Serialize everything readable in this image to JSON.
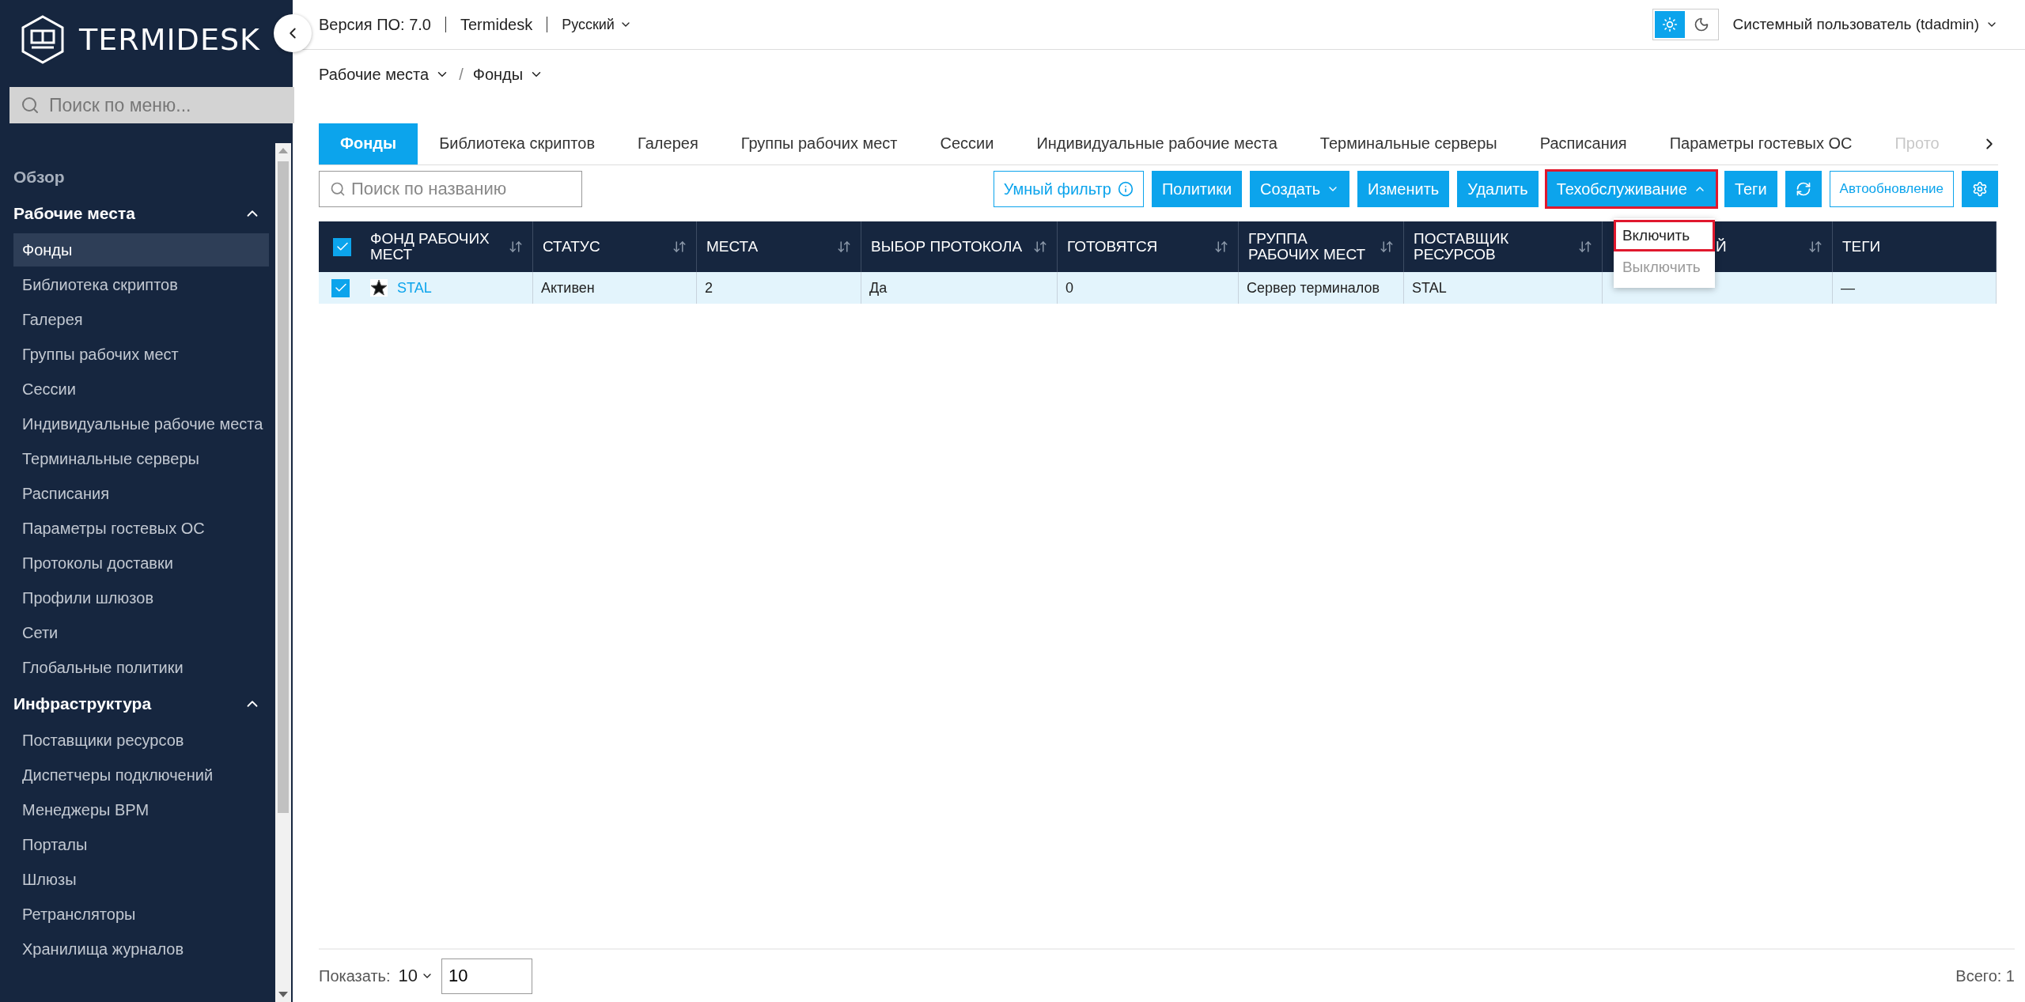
{
  "sidebar": {
    "logo": "TERMIDESK",
    "search": {
      "placeholder": "Поиск по меню..."
    },
    "sections": [
      {
        "kind": "link",
        "label": "Обзор"
      },
      {
        "kind": "group",
        "label": "Рабочие места",
        "expanded": true,
        "children": [
          {
            "label": "Фонды",
            "selected": true
          },
          {
            "label": "Библиотека скриптов",
            "selected": false
          },
          {
            "label": "Галерея",
            "selected": false
          },
          {
            "label": "Группы рабочих мест",
            "selected": false
          },
          {
            "label": "Сессии",
            "selected": false
          },
          {
            "label": "Индивидуальные рабочие места",
            "selected": false
          },
          {
            "label": "Терминальные серверы",
            "selected": false
          },
          {
            "label": "Расписания",
            "selected": false
          },
          {
            "label": "Параметры гостевых ОС",
            "selected": false
          },
          {
            "label": "Протоколы доставки",
            "selected": false
          },
          {
            "label": "Профили шлюзов",
            "selected": false
          },
          {
            "label": "Сети",
            "selected": false
          },
          {
            "label": "Глобальные политики",
            "selected": false
          }
        ]
      },
      {
        "kind": "group",
        "label": "Инфраструктура",
        "expanded": true,
        "children": [
          {
            "label": "Поставщики ресурсов",
            "selected": false
          },
          {
            "label": "Диспетчеры подключений",
            "selected": false
          },
          {
            "label": "Менеджеры ВРМ",
            "selected": false
          },
          {
            "label": "Порталы",
            "selected": false
          },
          {
            "label": "Шлюзы",
            "selected": false
          },
          {
            "label": "Ретрансляторы",
            "selected": false
          },
          {
            "label": "Хранилища журналов",
            "selected": false
          }
        ]
      }
    ]
  },
  "topbar": {
    "items": [
      "Версия ПО: 7.0",
      "Termidesk"
    ],
    "language": "Русский",
    "theme": [
      {
        "kind": "light",
        "selected": true
      },
      {
        "kind": "dark",
        "selected": false
      }
    ],
    "user": "Системный пользователь (tdadmin)"
  },
  "breadcrumb": {
    "separator": "/",
    "items": [
      "Рабочие места",
      "Фонды"
    ]
  },
  "tabs": [
    {
      "label": "Фонды",
      "selected": true,
      "faded": false
    },
    {
      "label": "Библиотека скриптов",
      "selected": false,
      "faded": false
    },
    {
      "label": "Галерея",
      "selected": false,
      "faded": false
    },
    {
      "label": "Группы рабочих мест",
      "selected": false,
      "faded": false
    },
    {
      "label": "Сессии",
      "selected": false,
      "faded": false
    },
    {
      "label": "Индивидуальные рабочие места",
      "selected": false,
      "faded": false
    },
    {
      "label": "Терминальные серверы",
      "selected": false,
      "faded": false
    },
    {
      "label": "Расписания",
      "selected": false,
      "faded": false
    },
    {
      "label": "Параметры гостевых ОС",
      "selected": false,
      "faded": false
    },
    {
      "label": "Прото",
      "selected": false,
      "faded": true
    }
  ],
  "toolbar": {
    "search": {
      "placeholder": "Поиск по названию"
    },
    "buttons": [
      {
        "kind": "filter",
        "label": "Умный фильтр",
        "highlighted": false
      },
      {
        "kind": "solid",
        "label": "Политики",
        "highlighted": false
      },
      {
        "kind": "dropdown",
        "label": "Создать",
        "expanded": false,
        "highlighted": false
      },
      {
        "kind": "solid",
        "label": "Изменить",
        "highlighted": false
      },
      {
        "kind": "solid",
        "label": "Удалить",
        "highlighted": false
      },
      {
        "kind": "dropdown",
        "label": "Техобслуживание",
        "expanded": true,
        "highlighted": true,
        "menu": [
          {
            "label": "Включить",
            "highlighted": true,
            "disabled": false
          },
          {
            "label": "Выключить",
            "highlighted": false,
            "disabled": true
          }
        ]
      },
      {
        "kind": "solid",
        "label": "Теги",
        "highlighted": false
      },
      {
        "kind": "refresh",
        "highlighted": false
      },
      {
        "kind": "outline",
        "label": "Автообновление",
        "highlighted": false
      },
      {
        "kind": "settings",
        "highlighted": false
      }
    ]
  },
  "table": {
    "select_all": {
      "checked": true
    },
    "columns": [
      {
        "label": "ФОНД РАБОЧИХ МЕСТ",
        "sortable": true
      },
      {
        "label": "СТАТУС",
        "sortable": true
      },
      {
        "label": "МЕСТА",
        "sortable": true
      },
      {
        "label": "ВЫБОР ПРОТОКОЛА",
        "sortable": true
      },
      {
        "label": "ГОТОВЯТСЯ",
        "sortable": true
      },
      {
        "label": "ГРУППА РАБОЧИХ МЕСТ",
        "sortable": true
      },
      {
        "label": "ПОСТАВЩИК РЕСУРСОВ",
        "sortable": true
      },
      {
        "label": "Й",
        "sortable": true
      },
      {
        "label": "ТЕГИ",
        "sortable": false
      }
    ],
    "rows": [
      {
        "selected": true,
        "checked": true,
        "cells": [
          "STAL",
          "Активен",
          "2",
          "Да",
          "0",
          "Сервер терминалов",
          "STAL",
          null,
          "—"
        ]
      }
    ]
  },
  "footer": {
    "show_label": "Показать:",
    "page_size": "10",
    "page_input": "10",
    "total": "Всего: 1"
  }
}
